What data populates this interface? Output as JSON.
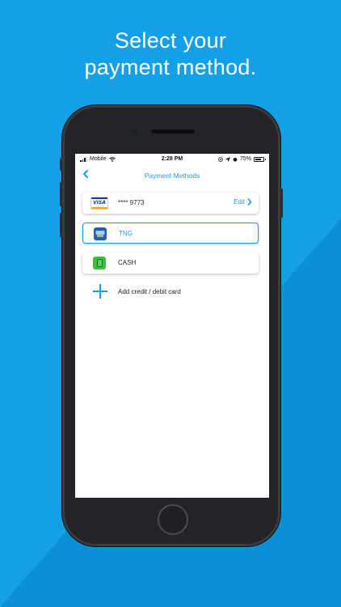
{
  "headline": {
    "line1": "Select your",
    "line2": "payment method."
  },
  "colors": {
    "background": "#14a0e6",
    "background_dark": "#0b8fd6",
    "accent": "#1c9be4"
  },
  "status_bar": {
    "carrier": "Mobile",
    "time": "2:28 PM",
    "battery_percent": "75%",
    "battery_level": 0.75,
    "icons": [
      "signal-icon",
      "wifi-icon",
      "location-icon",
      "alarm-icon",
      "battery-icon"
    ]
  },
  "nav": {
    "title": "Payment Methods",
    "back_icon": "chevron-left-icon"
  },
  "payment_methods": [
    {
      "icon": "visa-card-icon",
      "icon_text": "VISA",
      "label": "**** 9773",
      "action": "Edit",
      "selected": false
    },
    {
      "icon": "tng-wallet-icon",
      "label": "TNG",
      "selected": true
    },
    {
      "icon": "cash-icon",
      "label": "CASH",
      "selected": false
    }
  ],
  "add_card": {
    "icon": "plus-icon",
    "label": "Add credit / debit card"
  }
}
